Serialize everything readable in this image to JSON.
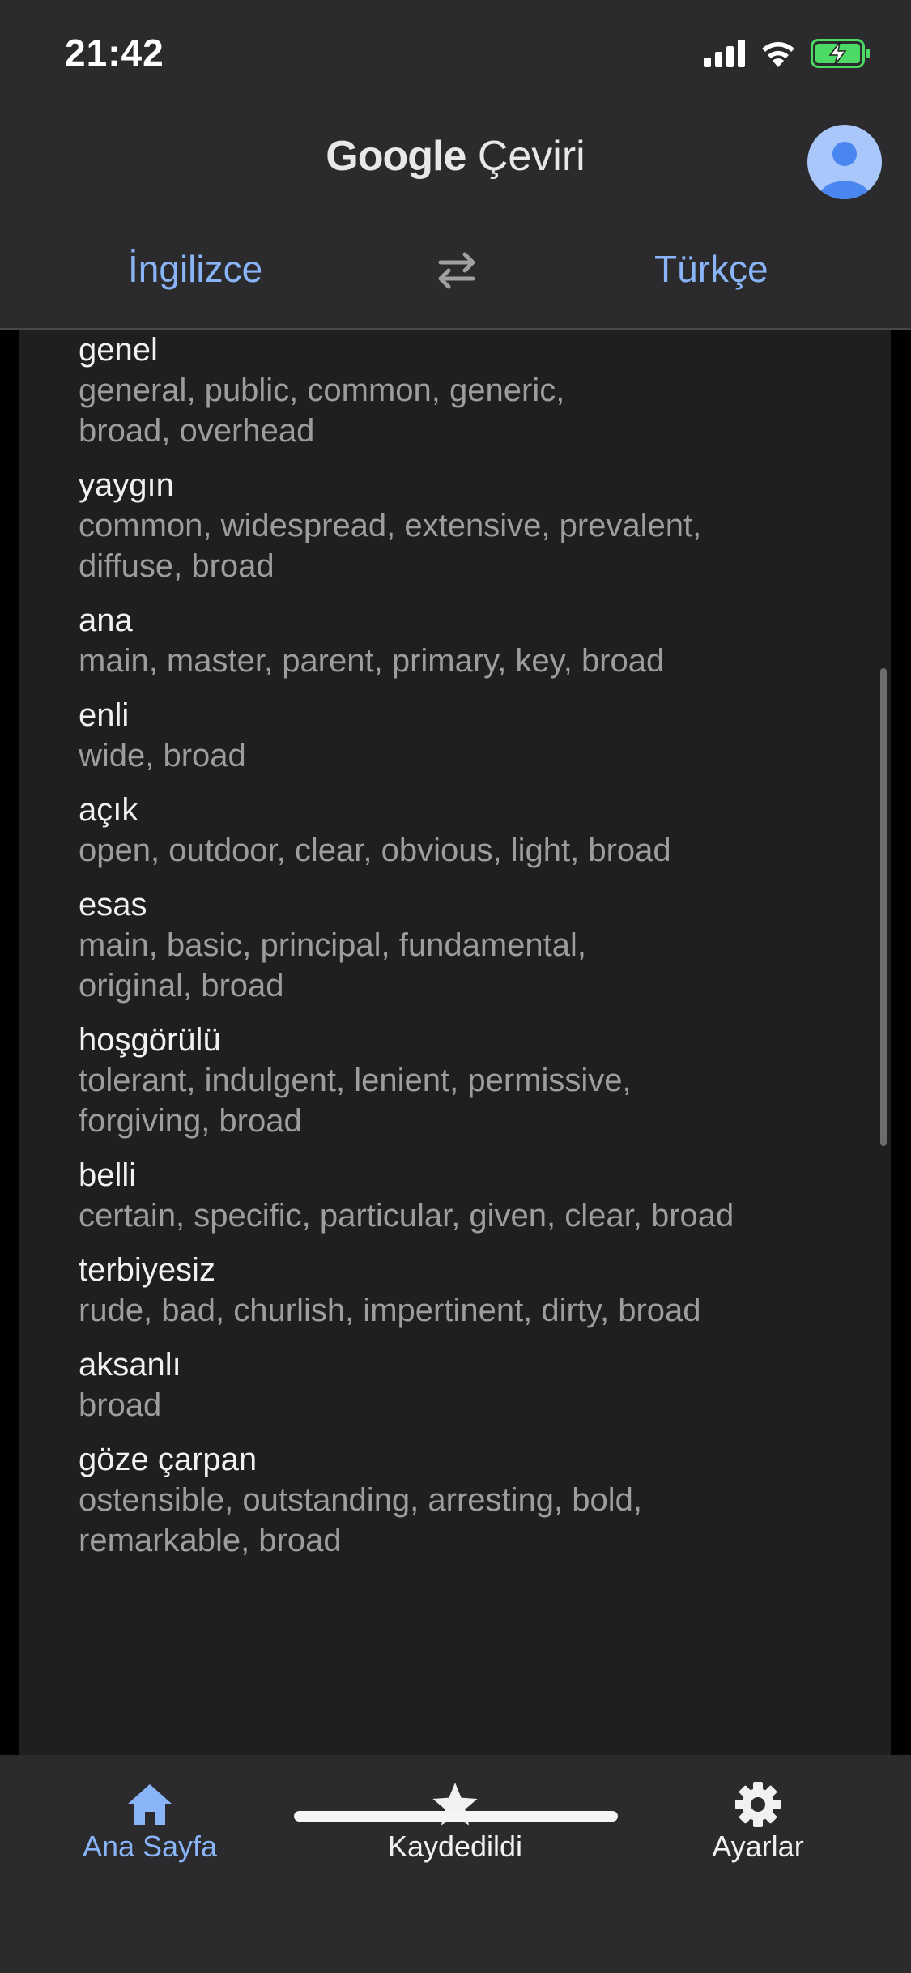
{
  "status": {
    "time": "21:42"
  },
  "app": {
    "title_brand": "Google",
    "title_product": "Çeviri"
  },
  "languages": {
    "source": "İngilizce",
    "target": "Türkçe"
  },
  "entries": [
    {
      "word": "genel",
      "translations": [
        "general, public, common, generic,",
        "broad, overhead"
      ]
    },
    {
      "word": "yaygın",
      "translations": [
        "common, widespread, extensive, prevalent,",
        "diffuse, broad"
      ]
    },
    {
      "word": "ana",
      "translations": [
        "main, master, parent, primary, key, broad"
      ]
    },
    {
      "word": "enli",
      "translations": [
        "wide, broad"
      ]
    },
    {
      "word": "açık",
      "translations": [
        "open, outdoor, clear, obvious, light, broad"
      ]
    },
    {
      "word": "esas",
      "translations": [
        "main, basic, principal, fundamental,",
        "original, broad"
      ]
    },
    {
      "word": "hoşgörülü",
      "translations": [
        "tolerant, indulgent, lenient, permissive,",
        "forgiving, broad"
      ]
    },
    {
      "word": "belli",
      "translations": [
        "certain, specific, particular, given, clear, broad"
      ]
    },
    {
      "word": "terbiyesiz",
      "translations": [
        "rude, bad, churlish, impertinent, dirty, broad"
      ]
    },
    {
      "word": "aksanlı",
      "translations": [
        "broad"
      ]
    },
    {
      "word": "göze çarpan",
      "translations": [
        "ostensible, outstanding, arresting, bold,",
        "remarkable, broad"
      ]
    }
  ],
  "nav": {
    "home": {
      "label": "Ana Sayfa",
      "icon": "home-icon"
    },
    "saved": {
      "label": "Kaydedildi",
      "icon": "star-icon"
    },
    "settings": {
      "label": "Ayarlar",
      "icon": "gear-icon"
    }
  },
  "colors": {
    "accent": "#8ab4f8",
    "battery": "#4cd964"
  }
}
